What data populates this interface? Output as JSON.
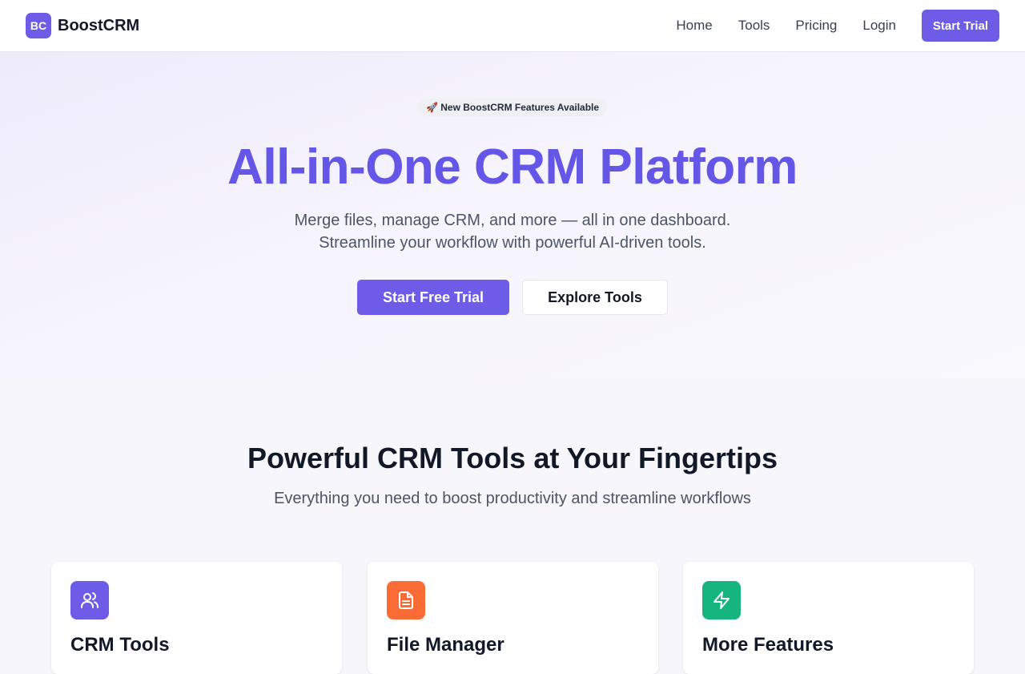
{
  "header": {
    "logo_badge": "BC",
    "brand": "BoostCRM",
    "nav": [
      "Home",
      "Tools",
      "Pricing",
      "Login"
    ],
    "cta": "Start Trial"
  },
  "hero": {
    "badge_icon": "rocket-icon",
    "badge_emoji": "🚀",
    "badge": "New BoostCRM Features Available",
    "title": "All-in-One CRM Platform",
    "subtitle_line1": "Merge files, manage CRM, and more — all in one dashboard.",
    "subtitle_line2": "Streamline your workflow with powerful AI-driven tools.",
    "primary_button": "Start Free Trial",
    "secondary_button": "Explore Tools"
  },
  "features": {
    "title": "Powerful CRM Tools at Your Fingertips",
    "subtitle": "Everything you need to boost productivity and streamline workflows",
    "cards": [
      {
        "icon": "users-icon",
        "color": "#6c5ce7",
        "title": "CRM Tools"
      },
      {
        "icon": "file-icon",
        "color": "#fb6b35",
        "title": "File Manager"
      },
      {
        "icon": "zap-icon",
        "color": "#16b47e",
        "title": "More Features"
      }
    ]
  },
  "colors": {
    "accent": "#6c5ce7",
    "orange": "#fb6b35",
    "green": "#16b47e"
  }
}
